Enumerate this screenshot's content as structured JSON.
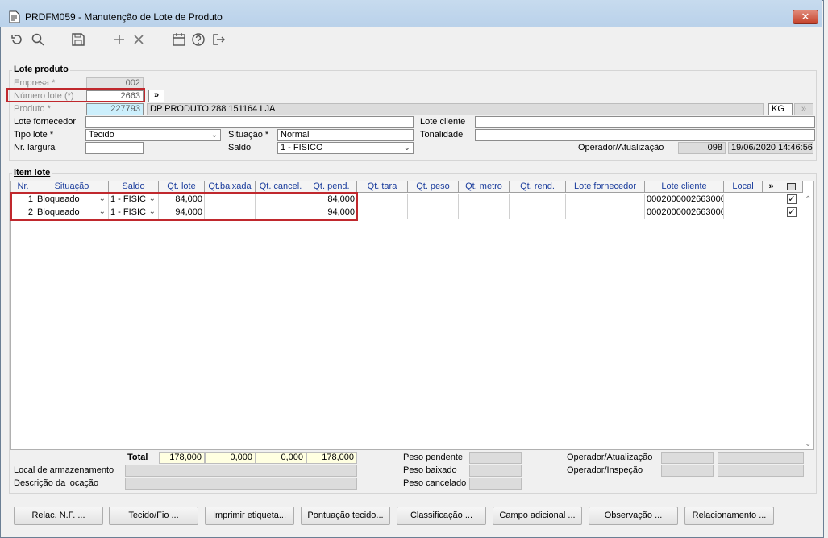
{
  "window": {
    "title": "PRDFM059 - Manutenção de Lote de Produto",
    "close": "✕"
  },
  "toolbar": [
    "undo-icon",
    "search-icon",
    "save-icon",
    "add-icon",
    "delete-icon",
    "calendar-icon",
    "help-icon",
    "exit-icon"
  ],
  "lote_produto": {
    "title": "Lote produto",
    "empresa_label": "Empresa *",
    "empresa": "002",
    "numero_lote_label": "Número lote (*)",
    "numero_lote": "2663",
    "more": "»",
    "produto_label": "Produto *",
    "produto_code": "227793",
    "produto_desc": "DP PRODUTO 288 151164 LJA",
    "unit": "KG",
    "lote_fornecedor_label": "Lote fornecedor",
    "lote_fornecedor": "",
    "lote_cliente_label": "Lote cliente",
    "lote_cliente": "",
    "tipo_lote_label": "Tipo lote *",
    "tipo_lote": "Tecido",
    "situacao_label": "Situação *",
    "situacao": "Normal",
    "tonalidade_label": "Tonalidade",
    "tonalidade": "",
    "nr_largura_label": "Nr. largura",
    "nr_largura": "",
    "saldo_label": "Saldo",
    "saldo": "1 - FISICO",
    "operador_label": "Operador/Atualização",
    "operador": "098",
    "data": "19/06/2020 14:46:56"
  },
  "item_lote": {
    "title": "Item lote",
    "columns": [
      "Nr.",
      "Situação",
      "Saldo",
      "Qt. lote",
      "Qt.baixada",
      "Qt. cancel.",
      "Qt. pend.",
      "Qt. tara",
      "Qt. peso",
      "Qt. metro",
      "Qt. rend.",
      "Lote fornecedor",
      "Lote cliente",
      "Local",
      "»"
    ],
    "rows": [
      {
        "nr": "1",
        "situacao": "Bloqueado",
        "saldo": "1 - FISIC",
        "qt_lote": "84,000",
        "qt_baixada": "",
        "qt_cancel": "",
        "qt_pend": "84,000",
        "qt_tara": "",
        "qt_peso": "",
        "qt_metro": "",
        "qt_rend": "",
        "lote_fornecedor": "",
        "lote_cliente": "0002000002663000",
        "local": "",
        "checked": true
      },
      {
        "nr": "2",
        "situacao": "Bloqueado",
        "saldo": "1 - FISIC",
        "qt_lote": "94,000",
        "qt_baixada": "",
        "qt_cancel": "",
        "qt_pend": "94,000",
        "qt_tara": "",
        "qt_peso": "",
        "qt_metro": "",
        "qt_rend": "",
        "lote_fornecedor": "",
        "lote_cliente": "0002000002663000",
        "local": "",
        "checked": true
      }
    ]
  },
  "totals": {
    "label": "Total",
    "qt_lote": "178,000",
    "qt_baixada": "0,000",
    "qt_cancel": "0,000",
    "qt_pend": "178,000",
    "local_armazenamento_label": "Local de armazenamento",
    "descricao_locacao_label": "Descrição da locação",
    "peso_pendente_label": "Peso pendente",
    "peso_baixado_label": "Peso baixado",
    "peso_cancelado_label": "Peso cancelado",
    "operador_atualizacao_label": "Operador/Atualização",
    "operador_inspecao_label": "Operador/Inspeção"
  },
  "buttons": [
    "Relac. N.F. ...",
    "Tecido/Fio ...",
    "Imprimir etiqueta...",
    "Pontuação tecido...",
    "Classificação ...",
    "Campo adicional ...",
    "Observação ...",
    "Relacionamento ..."
  ],
  "colors": {
    "red_highlight": "#c0282d",
    "header_text": "#1a3c9c",
    "total_bg": "#ffffe1"
  }
}
